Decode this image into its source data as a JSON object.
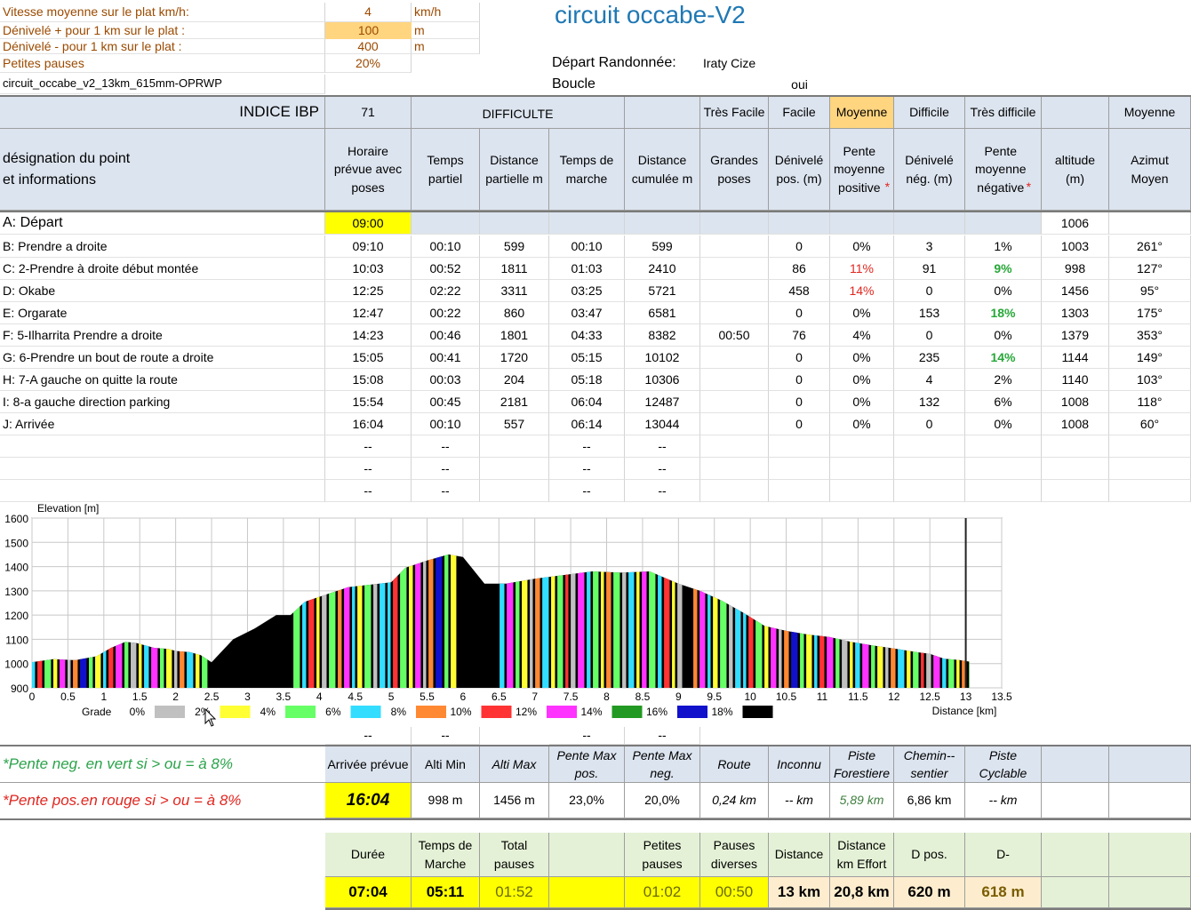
{
  "params": {
    "speed_label": "Vitesse moyenne sur le plat  km/h:",
    "speed_value": "4",
    "speed_unit": "km/h",
    "dplus_label": "Dénivelé + pour 1 km sur le plat :",
    "dplus_value": "100",
    "dplus_unit": "m",
    "dminus_label": "Dénivelé - pour 1 km sur le plat :",
    "dminus_value": "400",
    "dminus_unit": "m",
    "pauses_label": "Petites pauses",
    "pauses_value": "20%",
    "filename": "circuit_occabe_v2_13km_615mm-OPRWP",
    "title": "circuit  occabe-V2",
    "depart_label": "Départ Randonnée:",
    "depart_value": "Iraty Cize",
    "boucle_label": "Boucle",
    "boucle_value": "oui"
  },
  "ibp": {
    "label": "INDICE IBP",
    "value": "71",
    "difficulte": "DIFFICULTE",
    "levels": [
      "Très Facile",
      "Facile",
      "Moyenne",
      "Difficile",
      "Très difficile"
    ],
    "moyenne": "Moyenne"
  },
  "columns": {
    "designation": "désignation du point\net informations",
    "horaire": "Horaire\nprévue  avec\nposes",
    "temps_partiel": "Temps\npartiel",
    "distance_partielle": "Distance\npartielle m",
    "temps_marche": "Temps de\nmarche",
    "distance_cumulee": "Distance\ncumulée m",
    "grandes_poses": "Grandes\nposes",
    "denivele_pos": "Dénivelé\npos. (m)",
    "pente_pos": "Pente\nmoyenne\npositive",
    "denivele_neg": "Dénivelé\nnég. (m)",
    "pente_neg": "Pente\nmoyenne\nnégative",
    "altitude": "altitude\n(m)",
    "azimut": "Azimut\nMoyen"
  },
  "rows": [
    {
      "name": "A: Départ",
      "horaire": "09:00",
      "tp": "",
      "dp": "",
      "tm": "",
      "dc": "",
      "gp": "",
      "dpos": "",
      "ppos": "",
      "dneg": "",
      "pneg": "",
      "alt": "1006",
      "az": ""
    },
    {
      "name": "B: Prendre a droite",
      "horaire": "09:10",
      "tp": "00:10",
      "dp": "599",
      "tm": "00:10",
      "dc": "599",
      "gp": "",
      "dpos": "0",
      "ppos": "0%",
      "dneg": "3",
      "pneg": "1%",
      "alt": "1003",
      "az": "261°"
    },
    {
      "name": "C: 2-Prendre à droite début montée",
      "horaire": "10:03",
      "tp": "00:52",
      "dp": "1811",
      "tm": "01:03",
      "dc": "2410",
      "gp": "",
      "dpos": "86",
      "ppos": "11%",
      "dneg": "91",
      "pneg": "9%",
      "alt": "998",
      "az": "127°"
    },
    {
      "name": "D: Okabe",
      "horaire": "12:25",
      "tp": "02:22",
      "dp": "3311",
      "tm": "03:25",
      "dc": "5721",
      "gp": "",
      "dpos": "458",
      "ppos": "14%",
      "dneg": "0",
      "pneg": "0%",
      "alt": "1456",
      "az": "95°"
    },
    {
      "name": "E: Orgarate",
      "horaire": "12:47",
      "tp": "00:22",
      "dp": "860",
      "tm": "03:47",
      "dc": "6581",
      "gp": "",
      "dpos": "0",
      "ppos": "0%",
      "dneg": "153",
      "pneg": "18%",
      "alt": "1303",
      "az": "175°"
    },
    {
      "name": "F: 5-Ilharrita Prendre a droite",
      "horaire": "14:23",
      "tp": "00:46",
      "dp": "1801",
      "tm": "04:33",
      "dc": "8382",
      "gp": "00:50",
      "dpos": "76",
      "ppos": "4%",
      "dneg": "0",
      "pneg": "0%",
      "alt": "1379",
      "az": "353°"
    },
    {
      "name": "G: 6-Prendre un bout de route a droite",
      "horaire": "15:05",
      "tp": "00:41",
      "dp": "1720",
      "tm": "05:15",
      "dc": "10102",
      "gp": "",
      "dpos": "0",
      "ppos": "0%",
      "dneg": "235",
      "pneg": "14%",
      "alt": "1144",
      "az": "149°"
    },
    {
      "name": "H: 7-A gauche on quitte la route",
      "horaire": "15:08",
      "tp": "00:03",
      "dp": "204",
      "tm": "05:18",
      "dc": "10306",
      "gp": "",
      "dpos": "0",
      "ppos": "0%",
      "dneg": "4",
      "pneg": "2%",
      "alt": "1140",
      "az": "103°"
    },
    {
      "name": "I: 8-a gauche direction parking",
      "horaire": "15:54",
      "tp": "00:45",
      "dp": "2181",
      "tm": "06:04",
      "dc": "12487",
      "gp": "",
      "dpos": "0",
      "ppos": "0%",
      "dneg": "132",
      "pneg": "6%",
      "alt": "1008",
      "az": "118°"
    },
    {
      "name": "J: Arrivée",
      "horaire": "16:04",
      "tp": "00:10",
      "dp": "557",
      "tm": "06:14",
      "dc": "13044",
      "gp": "",
      "dpos": "0",
      "ppos": "0%",
      "dneg": "0",
      "pneg": "0%",
      "alt": "1008",
      "az": "60°"
    }
  ],
  "dash": "--",
  "chart_data": {
    "type": "area",
    "ylabel": "Elevation [m]",
    "xlabel": "Distance [km]",
    "xlim": [
      0,
      13.5
    ],
    "ylim": [
      900,
      1600
    ],
    "xticks": [
      "0",
      "0.5",
      "1",
      "1.5",
      "2",
      "2.5",
      "3",
      "3.5",
      "4",
      "4.5",
      "5",
      "5.5",
      "6",
      "6.5",
      "7",
      "7.5",
      "8",
      "8.5",
      "9",
      "9.5",
      "10",
      "10.5",
      "11",
      "11.5",
      "12",
      "12.5",
      "13",
      "13.5"
    ],
    "yticks": [
      "1600",
      "1500",
      "1400",
      "1300",
      "1200",
      "1100",
      "1000",
      "900"
    ],
    "legend_title": "Grade",
    "legend": [
      {
        "label": "0%",
        "color": "#c0c0c0"
      },
      {
        "label": "2%",
        "color": "#ffff33"
      },
      {
        "label": "4%",
        "color": "#66ff66"
      },
      {
        "label": "6%",
        "color": "#33ddff"
      },
      {
        "label": "8%",
        "color": "#ff8833"
      },
      {
        "label": "10%",
        "color": "#ff3333"
      },
      {
        "label": "12%",
        "color": "#ff33ff"
      },
      {
        "label": "14%",
        "color": "#229922"
      },
      {
        "label": "16%",
        "color": "#1111cc"
      },
      {
        "label": "18%",
        "color": "#000000"
      }
    ],
    "x": [
      0,
      0.3,
      0.6,
      0.9,
      1.1,
      1.3,
      1.45,
      1.7,
      1.9,
      2.0,
      2.2,
      2.35,
      2.5,
      2.8,
      3.1,
      3.4,
      3.6,
      3.8,
      4.1,
      4.4,
      4.7,
      5.0,
      5.2,
      5.5,
      5.8,
      6.0,
      6.3,
      6.6,
      7.0,
      7.4,
      7.8,
      8.2,
      8.6,
      9.0,
      9.3,
      9.6,
      9.9,
      10.2,
      10.5,
      10.8,
      11.1,
      11.4,
      11.7,
      12.0,
      12.3,
      12.5,
      12.7,
      12.9,
      13.05
    ],
    "y": [
      1006,
      1018,
      1014,
      1030,
      1065,
      1090,
      1085,
      1065,
      1060,
      1052,
      1047,
      1035,
      1005,
      1100,
      1145,
      1200,
      1200,
      1255,
      1285,
      1315,
      1325,
      1335,
      1395,
      1425,
      1450,
      1440,
      1330,
      1330,
      1350,
      1365,
      1380,
      1375,
      1380,
      1330,
      1300,
      1260,
      1210,
      1155,
      1135,
      1120,
      1110,
      1090,
      1075,
      1062,
      1048,
      1040,
      1020,
      1015,
      1008
    ]
  },
  "legend_notes": {
    "neg": "*Pente neg. en vert si > ou = à 8%",
    "pos": "*Pente pos.en rouge si > ou = à 8%"
  },
  "summary1": {
    "headers": [
      "Arrivée prévue",
      "Alti Min",
      "Alti Max",
      "Pente Max\npos.",
      "Pente Max\nneg.",
      "Route",
      "Inconnu",
      "Piste\nForestiere",
      "Chemin--\nsentier",
      "Piste\nCyclable"
    ],
    "values": [
      "16:04",
      "998 m",
      "1456 m",
      "23,0%",
      "20,0%",
      "0,24 km",
      "-- km",
      "5,89 km",
      "6,86 km",
      "-- km"
    ]
  },
  "summary2": {
    "headers": [
      "Durée",
      "Temps de Marche",
      "Total\npauses",
      "",
      "Petites\npauses",
      "Pauses\ndiverses",
      "Distance",
      "Distance\nkm Effort",
      "D pos.",
      "D-"
    ],
    "values": [
      "07:04",
      "05:11",
      "01:52",
      "",
      "01:02",
      "00:50",
      "13 km",
      "20,8 km",
      "620 m",
      "618 m"
    ]
  }
}
